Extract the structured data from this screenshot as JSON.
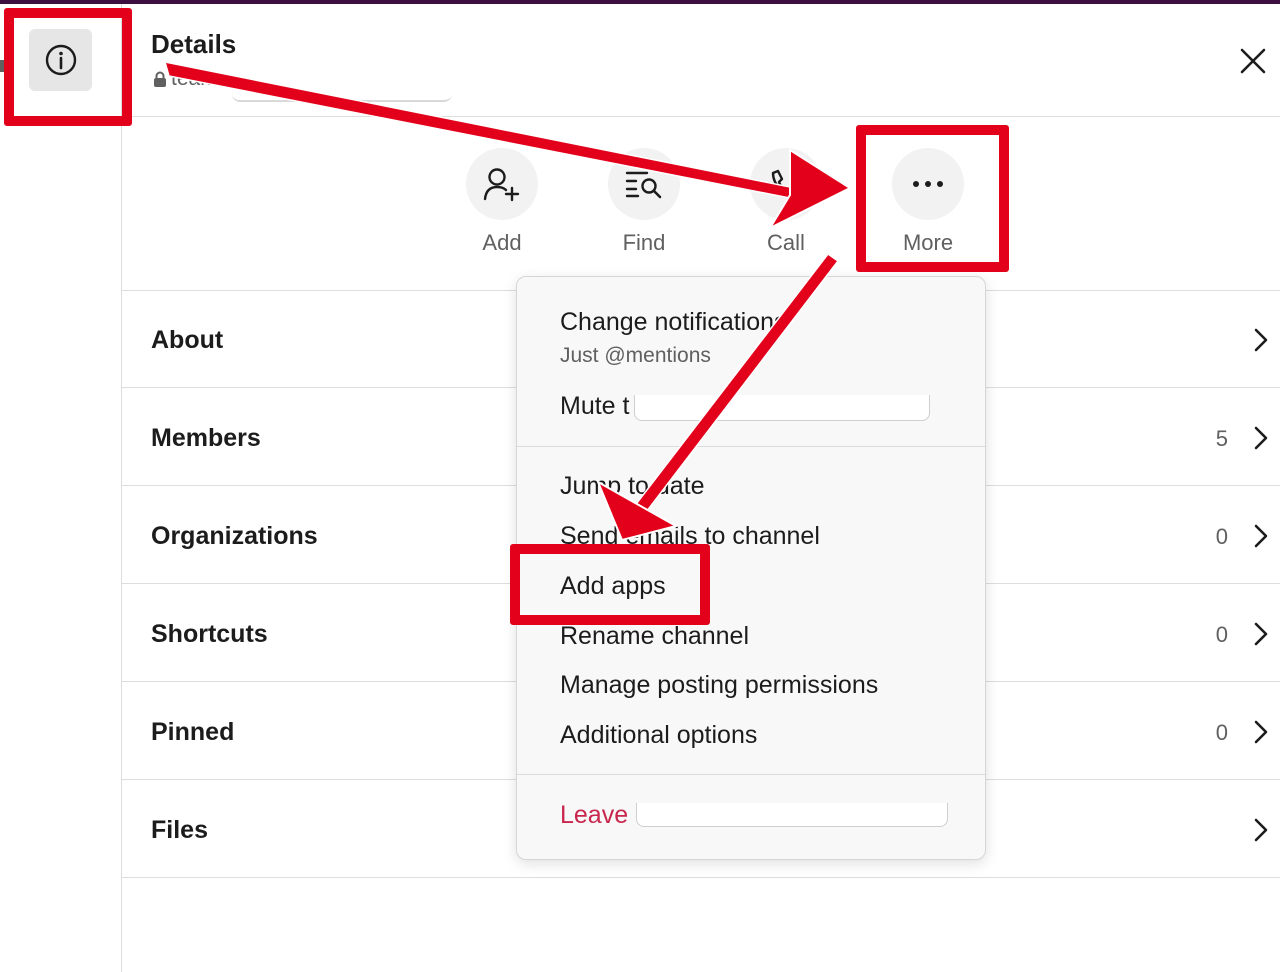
{
  "header": {
    "title": "Details",
    "channel_prefix": "team-",
    "info_icon": "info-icon",
    "close_icon": "close-icon"
  },
  "actions": [
    {
      "label": "Add",
      "icon": "add-person-icon"
    },
    {
      "label": "Find",
      "icon": "find-icon"
    },
    {
      "label": "Call",
      "icon": "call-icon"
    },
    {
      "label": "More",
      "icon": "more-icon"
    }
  ],
  "rows": [
    {
      "title": "About",
      "count": ""
    },
    {
      "title": "Members",
      "count": "5"
    },
    {
      "title": "Organizations",
      "count": "0"
    },
    {
      "title": "Shortcuts",
      "count": "0"
    },
    {
      "title": "Pinned",
      "count": "0"
    },
    {
      "title": "Files",
      "count": ""
    }
  ],
  "menu": {
    "change_notifications": "Change notifications",
    "notifications_value": "Just @mentions",
    "mute_prefix": "Mute t",
    "jump_to_date": "Jump to date",
    "send_emails": "Send emails to channel",
    "add_apps": "Add apps",
    "rename_channel": "Rename channel",
    "manage_posting": "Manage posting permissions",
    "additional_options": "Additional options",
    "leave_prefix": "Leave "
  },
  "annotation_colors": {
    "highlight": "#e3001b",
    "danger_text": "#c8264d"
  }
}
